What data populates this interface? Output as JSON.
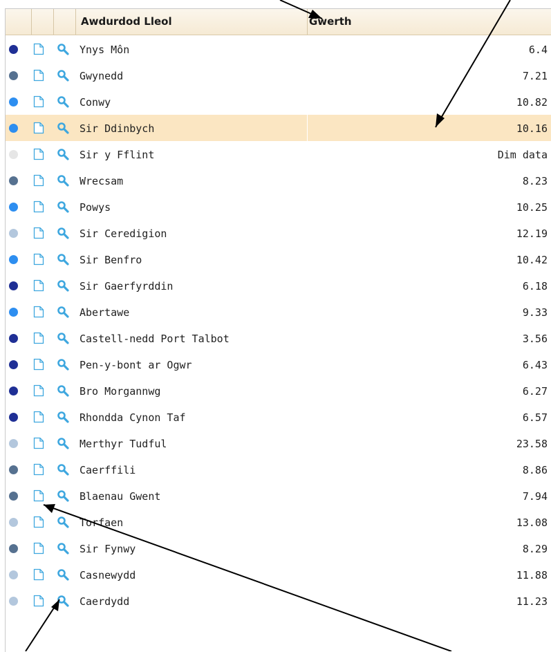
{
  "columns": {
    "name_header": "Awdurdod Lleol",
    "value_header": "Gwerth"
  },
  "colors": {
    "dark": "#1f2f95",
    "slate": "#567190",
    "bright": "#2d8ef0",
    "light": "#b3c7dd",
    "none": "#e6e6e6",
    "icon_blue": "#3ea7df",
    "selected_row": "#fbe6c2"
  },
  "icons": {
    "document": "document-icon",
    "search": "magnifier-icon"
  },
  "rows": [
    {
      "name": "Ynys Môn",
      "value": "6.4",
      "level": "dark"
    },
    {
      "name": "Gwynedd",
      "value": "7.21",
      "level": "slate"
    },
    {
      "name": "Conwy",
      "value": "10.82",
      "level": "bright"
    },
    {
      "name": "Sir Ddinbych",
      "value": "10.16",
      "level": "bright",
      "selected": true
    },
    {
      "name": "Sir y Fflint",
      "value": "Dim data",
      "level": "none"
    },
    {
      "name": "Wrecsam",
      "value": "8.23",
      "level": "slate"
    },
    {
      "name": "Powys",
      "value": "10.25",
      "level": "bright"
    },
    {
      "name": "Sir Ceredigion",
      "value": "12.19",
      "level": "light"
    },
    {
      "name": "Sir Benfro",
      "value": "10.42",
      "level": "bright"
    },
    {
      "name": "Sir Gaerfyrddin",
      "value": "6.18",
      "level": "dark"
    },
    {
      "name": "Abertawe",
      "value": "9.33",
      "level": "bright"
    },
    {
      "name": "Castell-nedd Port Talbot",
      "value": "3.56",
      "level": "dark"
    },
    {
      "name": "Pen-y-bont ar Ogwr",
      "value": "6.43",
      "level": "dark"
    },
    {
      "name": "Bro Morgannwg",
      "value": "6.27",
      "level": "dark"
    },
    {
      "name": "Rhondda Cynon Taf",
      "value": "6.57",
      "level": "dark"
    },
    {
      "name": "Merthyr Tudful",
      "value": "23.58",
      "level": "light"
    },
    {
      "name": "Caerffili",
      "value": "8.86",
      "level": "slate"
    },
    {
      "name": "Blaenau Gwent",
      "value": "7.94",
      "level": "slate"
    },
    {
      "name": "Torfaen",
      "value": "13.08",
      "level": "light"
    },
    {
      "name": "Sir Fynwy",
      "value": "8.29",
      "level": "slate"
    },
    {
      "name": "Casnewydd",
      "value": "11.88",
      "level": "light"
    },
    {
      "name": "Caerdydd",
      "value": "11.23",
      "level": "light"
    }
  ]
}
